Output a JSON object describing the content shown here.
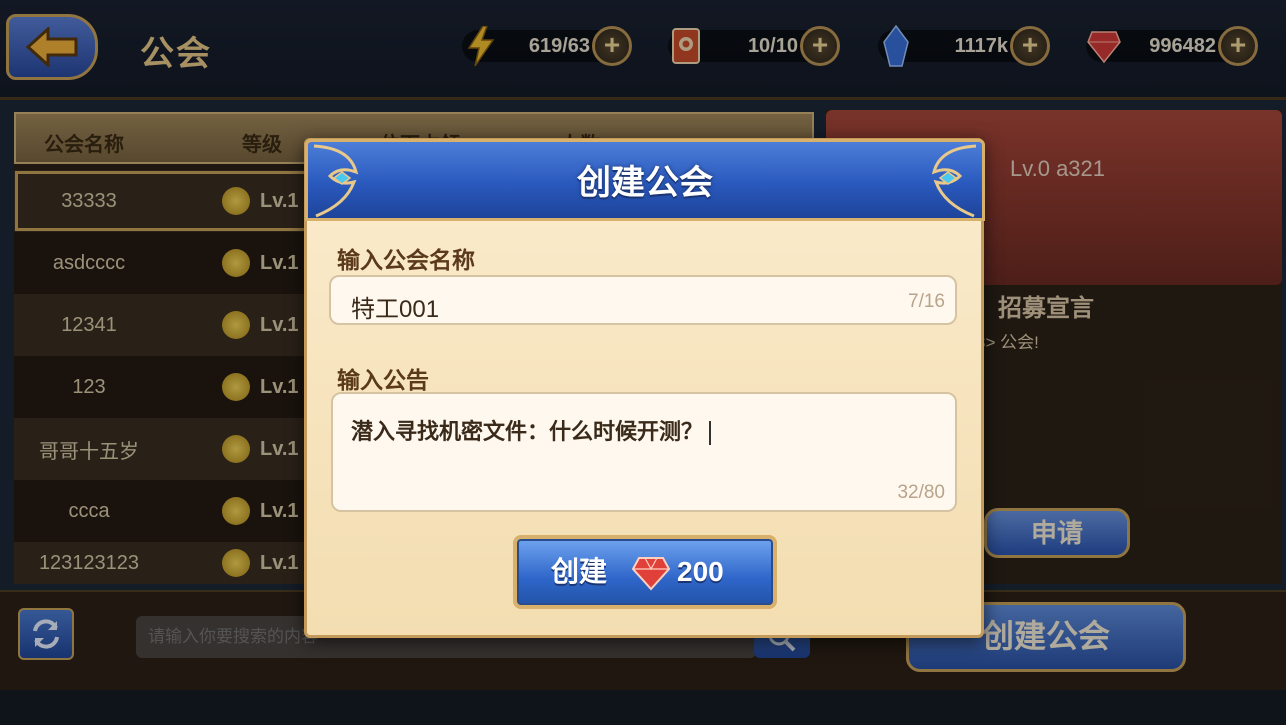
{
  "topbar": {
    "title": "公会",
    "resources": [
      {
        "icon": "lightning-icon",
        "value": "619/63",
        "color": "#f0c030"
      },
      {
        "icon": "ticket-icon",
        "value": "10/10",
        "color": "#c84a2a"
      },
      {
        "icon": "crystal-icon",
        "value": "1117k",
        "color": "#3a6fd8"
      },
      {
        "icon": "ruby-icon",
        "value": "996482",
        "color": "#d23a3a"
      }
    ]
  },
  "list": {
    "headers": [
      "公会名称",
      "等级",
      "位面占领",
      "人数"
    ],
    "rows": [
      {
        "name": "33333",
        "level": "Lv.1"
      },
      {
        "name": "asdcccc",
        "level": "Lv.1"
      },
      {
        "name": "12341",
        "level": "Lv.1"
      },
      {
        "name": "123",
        "level": "Lv.1"
      },
      {
        "name": "哥哥十五岁",
        "level": "Lv.1"
      },
      {
        "name": "ccca",
        "level": "Lv.1"
      },
      {
        "name": "123123123",
        "level": "Lv.1"
      }
    ]
  },
  "detail": {
    "level_name": "Lv.0   a321",
    "recruit_title": "招募宣言",
    "recruit_text": "3> 公会!",
    "apply_label": "申请"
  },
  "bottom": {
    "search_placeholder": "请输入你要搜索的内容",
    "create_guild_label": "创建公会"
  },
  "modal": {
    "title": "创建公会",
    "name_label": "输入公会名称",
    "name_value": "特工001",
    "name_counter": "7/16",
    "notice_label": "输入公告",
    "notice_value": "潜入寻找机密文件：什么时候开测？",
    "notice_counter": "32/80",
    "create_label": "创建",
    "create_cost": "200"
  }
}
